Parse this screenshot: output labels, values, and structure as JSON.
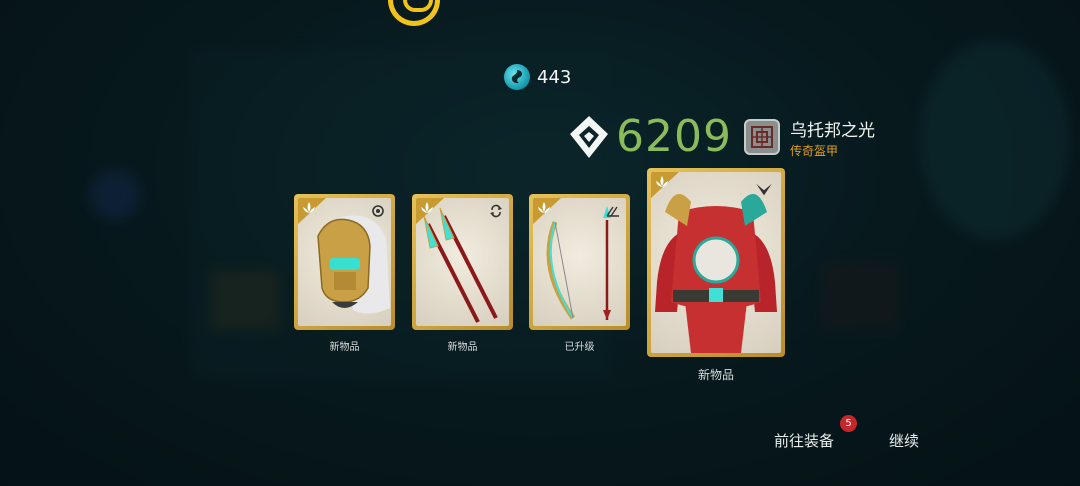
{
  "currency": {
    "icon": "swirl-currency-icon",
    "amount": "443"
  },
  "power": {
    "icon": "power-level-icon",
    "value": "6209"
  },
  "armor_set": {
    "icon": "armor-set-emblem-icon",
    "name": "乌托邦之光",
    "type": "传奇盔甲"
  },
  "items": [
    {
      "label": "新物品",
      "slot_icon": "helmet-slot-icon",
      "art": "golden-helmet-art",
      "rarity_icon": "lotus-icon"
    },
    {
      "label": "新物品",
      "slot_icon": "swap-slot-icon",
      "art": "twin-spears-art",
      "rarity_icon": "lotus-icon"
    },
    {
      "label": "已升级",
      "slot_icon": "bow-slot-icon",
      "art": "bow-and-arrow-art",
      "rarity_icon": "lotus-icon"
    },
    {
      "label": "新物品",
      "slot_icon": "chevron-down-icon",
      "art": "armor-set-art",
      "rarity_icon": "lotus-icon"
    }
  ],
  "footer": {
    "equip_label": "前往装备",
    "equip_count": "5",
    "continue_label": "继续"
  },
  "colors": {
    "card_gold": "#d6ae47",
    "power_green": "#8cbb5a",
    "legendary_orange": "#e0a01e",
    "badge_red": "#c6262a"
  }
}
